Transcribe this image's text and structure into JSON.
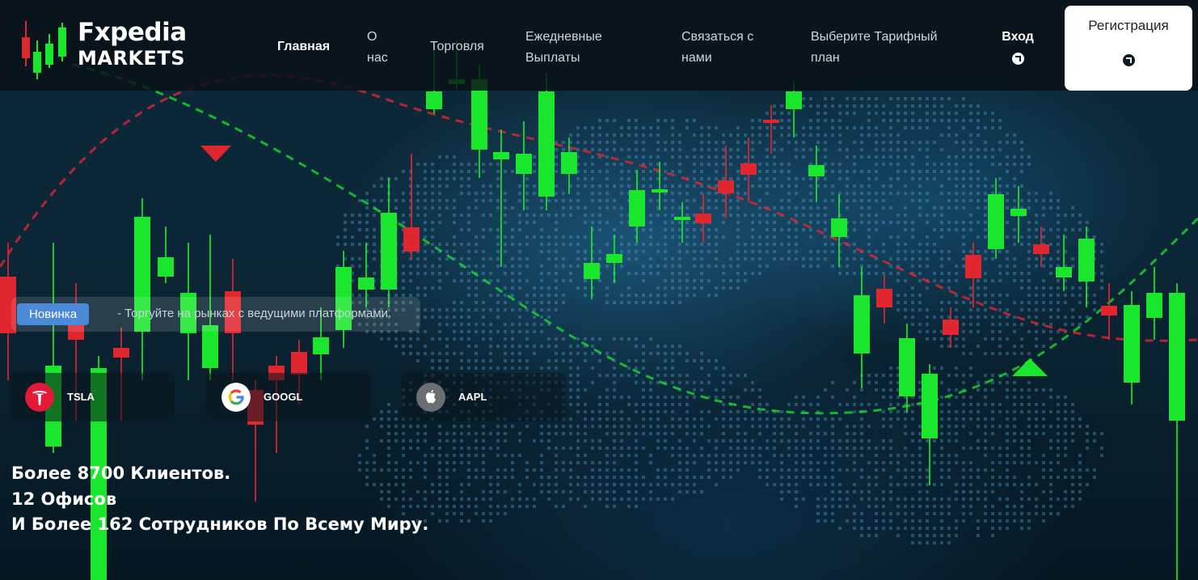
{
  "brand": {
    "logo_line1": "Fxpedia",
    "logo_line2": "MARKETS"
  },
  "nav": {
    "home": "Главная",
    "about": "О нас",
    "trade": "Торговля",
    "payouts": "Ежедневные Выплаты",
    "contact": "Связаться с нами",
    "plan": "Выберите Тарифный план",
    "login": "Вход",
    "register": "Регистрация"
  },
  "news": {
    "badge": "Новинка",
    "text": "- Торгуйте на рынках с ведущими платформами."
  },
  "tickers": [
    {
      "symbol": "TSLA",
      "icon": "tesla-icon"
    },
    {
      "symbol": "GOOGL",
      "icon": "google-icon"
    },
    {
      "symbol": "AAPL",
      "icon": "apple-icon"
    }
  ],
  "stats": [
    "Более 8700 Клиентов.",
    "12 Офисов",
    "И Более 162 Сотрудников По Всему Миру."
  ],
  "colors": {
    "candle_up": "#19e62c",
    "candle_down": "#e0262f",
    "badge": "#4a8ad9",
    "header_bg": "#08101699"
  }
}
